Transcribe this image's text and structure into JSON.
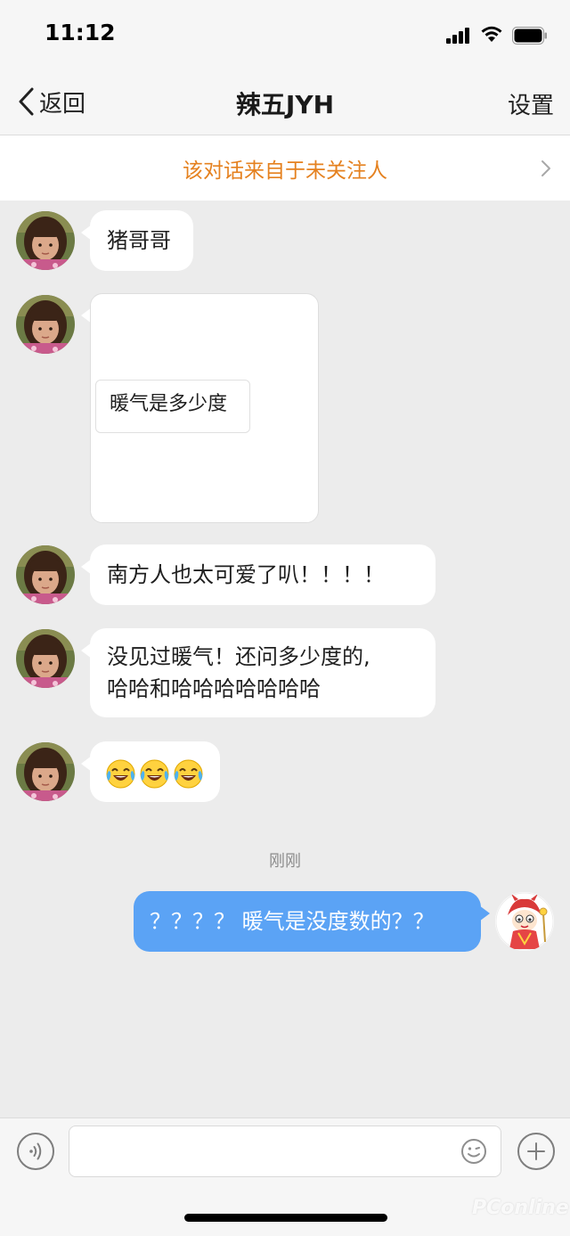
{
  "status_bar": {
    "time": "11:12"
  },
  "nav": {
    "back_label": "返回",
    "title": "辣五JYH",
    "settings_label": "设置"
  },
  "notice": {
    "text": "该对话来自于未关注人"
  },
  "messages": {
    "m1": "猪哥哥",
    "m2_card": "暖气是多少度",
    "m3": "南方人也太可爱了叭！！！！",
    "m4_line1": "没见过暖气！还问多少度的,",
    "m4_line2": "哈哈和哈哈哈哈哈哈哈",
    "m5_emojis": [
      "face-with-tears-of-joy",
      "face-with-tears-of-joy",
      "face-with-tears-of-joy"
    ]
  },
  "timestamp": "刚刚",
  "my_message": "？？？？ 暖气是没度数的？？",
  "input": {
    "placeholder": ""
  },
  "watermark": "PConline",
  "colors": {
    "my_bubble": "#5ba3f5",
    "notice_text": "#e5811f",
    "background": "#ececec"
  }
}
